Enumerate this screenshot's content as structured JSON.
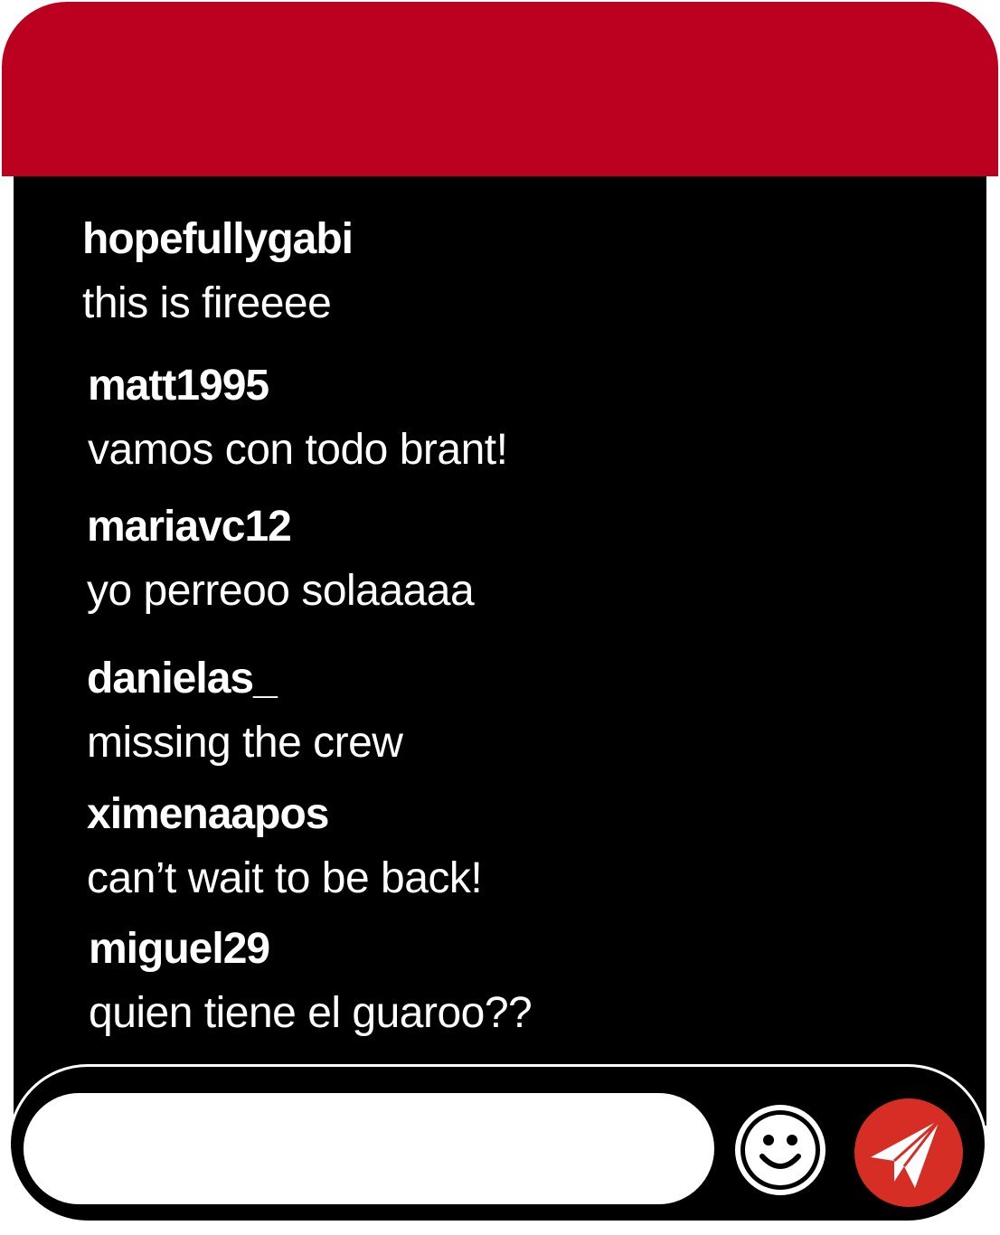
{
  "header": {
    "color": "#bb0020"
  },
  "messages": [
    {
      "username": "hopefullygabi",
      "text": "this is fireeee"
    },
    {
      "username": "matt1995",
      "text": "vamos con todo brant!"
    },
    {
      "username": "mariavc12",
      "text": "yo perreoo solaaaaa"
    },
    {
      "username": "danielas_",
      "text": "missing the crew"
    },
    {
      "username": "ximenaapos",
      "text": "can’t wait to be back!"
    },
    {
      "username": "miguel29",
      "text": "quien tiene el guaroo??"
    }
  ],
  "composer": {
    "input_value": "",
    "emoji_icon": "smiley-face-icon",
    "send_icon": "paper-plane-icon",
    "send_color": "#d62d24"
  }
}
